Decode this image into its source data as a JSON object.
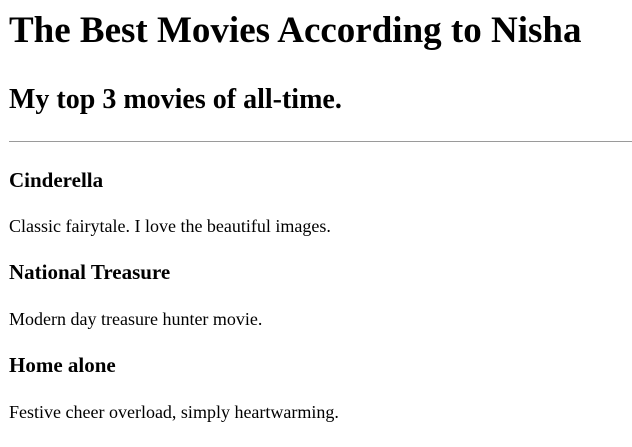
{
  "page": {
    "title": "The Best Movies According to Nisha",
    "subtitle": "My top 3 movies of all-time."
  },
  "movies": [
    {
      "title": "Cinderella",
      "description": "Classic fairytale. I love the beautiful images."
    },
    {
      "title": "National Treasure",
      "description": "Modern day treasure hunter movie."
    },
    {
      "title": "Home alone",
      "description": "Festive cheer overload, simply heartwarming."
    }
  ],
  "colors": {
    "text": "#000000",
    "background": "#ffffff",
    "divider": "#9a9a9a"
  }
}
